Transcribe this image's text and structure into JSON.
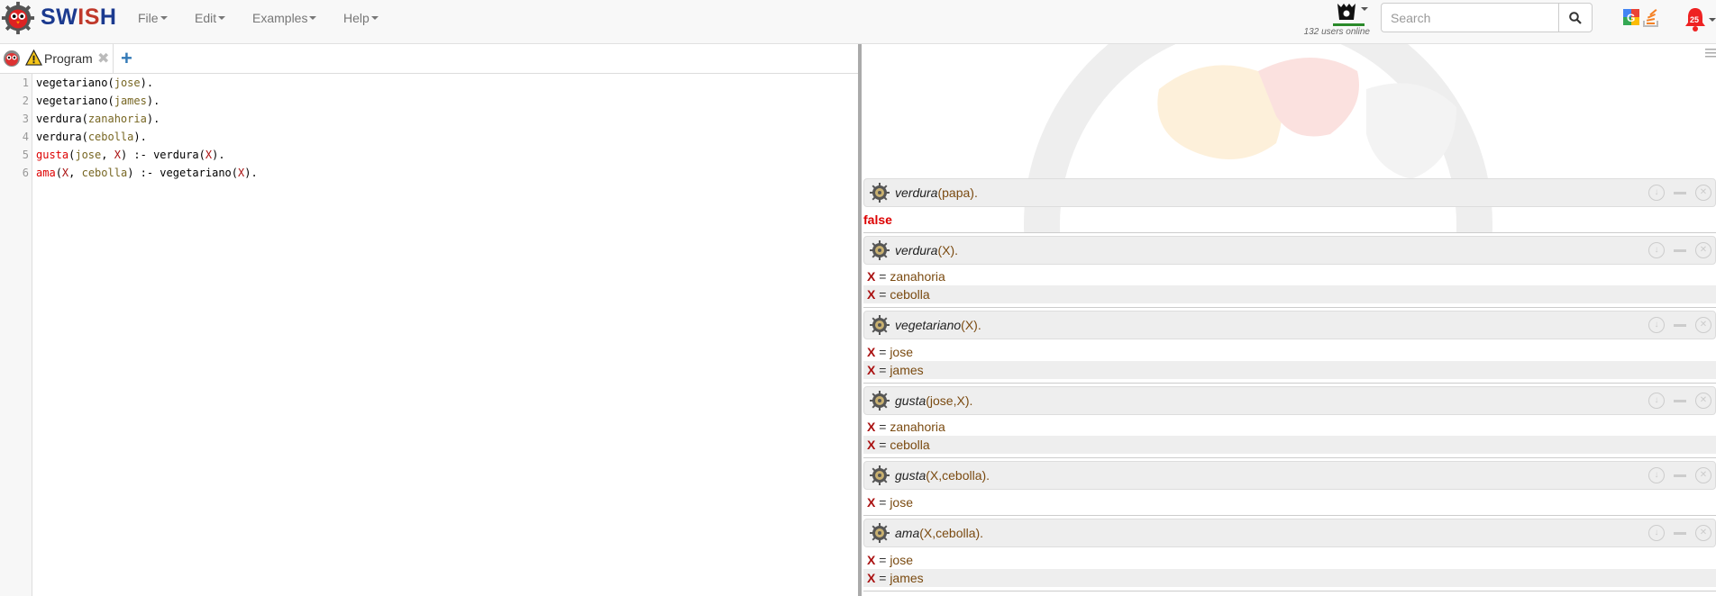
{
  "app": {
    "name_part1": "SW",
    "name_part2": "IS",
    "name_part3": "H"
  },
  "menu": [
    {
      "label": "File"
    },
    {
      "label": "Edit"
    },
    {
      "label": "Examples"
    },
    {
      "label": "Help"
    }
  ],
  "users_online": "132 users online",
  "search": {
    "placeholder": "Search",
    "value": ""
  },
  "notifications": {
    "count": "25"
  },
  "tab": {
    "label": "Program"
  },
  "code_lines": [
    {
      "n": "1",
      "text": "vegetariano(jose)."
    },
    {
      "n": "2",
      "text": "vegetariano(james)."
    },
    {
      "n": "3",
      "text": "verdura(zanahoria)."
    },
    {
      "n": "4",
      "text": "verdura(cebolla)."
    },
    {
      "n": "5",
      "text": "gusta(jose, X) :- verdura(X)."
    },
    {
      "n": "6",
      "text": "ama(X, cebolla) :- vegetariano(X)."
    }
  ],
  "queries": [
    {
      "pred": "verdura",
      "args": "(papa).",
      "result": "false",
      "answers": []
    },
    {
      "pred": "verdura",
      "args": "(X).",
      "answers": [
        {
          "var": "X",
          "val": "zanahoria"
        },
        {
          "var": "X",
          "val": "cebolla"
        }
      ]
    },
    {
      "pred": "vegetariano",
      "args": "(X).",
      "answers": [
        {
          "var": "X",
          "val": "jose"
        },
        {
          "var": "X",
          "val": "james"
        }
      ]
    },
    {
      "pred": "gusta",
      "args": "(jose,X).",
      "answers": [
        {
          "var": "X",
          "val": "zanahoria"
        },
        {
          "var": "X",
          "val": "cebolla"
        }
      ]
    },
    {
      "pred": "gusta",
      "args": "(X,cebolla).",
      "answers": [
        {
          "var": "X",
          "val": "jose"
        }
      ]
    },
    {
      "pred": "ama",
      "args": "(X,cebolla).",
      "answers": [
        {
          "var": "X",
          "val": "jose"
        },
        {
          "var": "X",
          "val": "james"
        }
      ]
    }
  ],
  "equals": "="
}
